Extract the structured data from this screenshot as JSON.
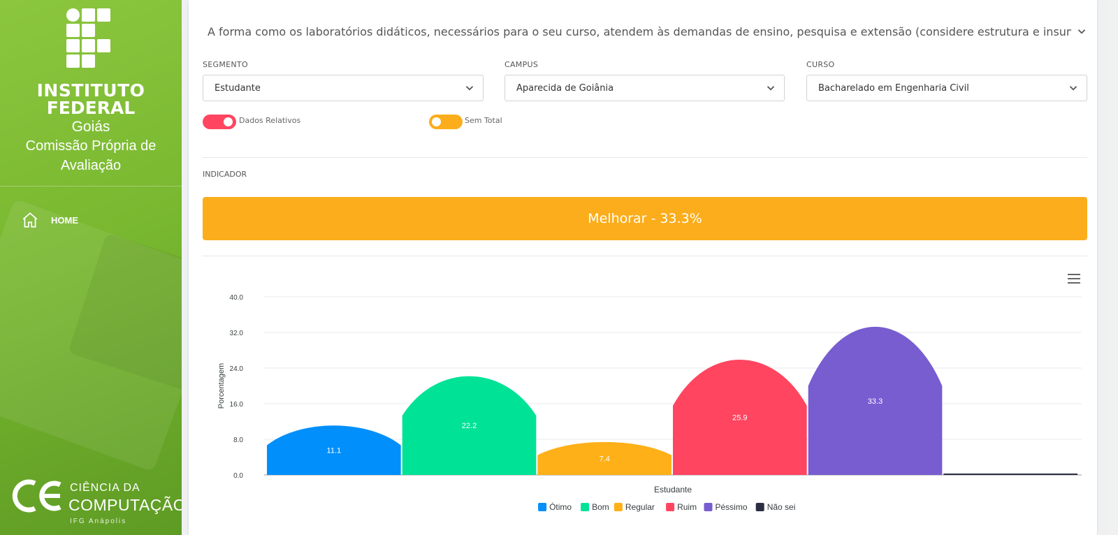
{
  "sidebar": {
    "brand_line1": "INSTITUTO",
    "brand_line2": "FEDERAL",
    "brand_line3": "Goiás",
    "brand_line4": "Comissão Própria de Avaliação",
    "nav_home": "HOME",
    "cc_line1": "CIÊNCIA DA",
    "cc_line2": "COMPUTAÇÃO",
    "cc_line3": "IFG Anápolis"
  },
  "question": "A forma como os laboratórios didáticos, necessários para o seu curso, atendem às demandas de ensino, pesquisa e extensão (considere estrutura e insumos",
  "filters": {
    "segmento_label": "SEGMENTO",
    "segmento_value": "Estudante",
    "campus_label": "CAMPUS",
    "campus_value": "Aparecida de Goiânia",
    "curso_label": "CURSO",
    "curso_value": "Bacharelado em Engenharia Civil"
  },
  "toggles": {
    "relativos_label": "Dados Relativos",
    "relativos_color": "#ff4560",
    "total_label": "Sem Total",
    "total_color": "#fbad1b"
  },
  "indicator": {
    "label": "INDICADOR",
    "text": "Melhorar - 33.3%",
    "color": "#fbad1b"
  },
  "chart_data": {
    "type": "bar",
    "xlabel": "Estudante",
    "ylabel": "Porcentagem",
    "ylim": [
      0,
      40
    ],
    "yticks": [
      "0.0",
      "8.0",
      "16.0",
      "24.0",
      "32.0",
      "40.0"
    ],
    "grid": true,
    "legend_position": "bottom",
    "series": [
      {
        "name": "Ótimo",
        "value": 11.1,
        "label": "11.1",
        "color": "#008ffb"
      },
      {
        "name": "Bom",
        "value": 22.2,
        "label": "22.2",
        "color": "#00e396"
      },
      {
        "name": "Regular",
        "value": 7.4,
        "label": "7.4",
        "color": "#feb019"
      },
      {
        "name": "Ruim",
        "value": 25.9,
        "label": "25.9",
        "color": "#ff4560"
      },
      {
        "name": "Péssimo",
        "value": 33.3,
        "label": "33.3",
        "color": "#775dd0"
      },
      {
        "name": "Não sei",
        "value": 0,
        "label": "",
        "color": "#2b2d42"
      }
    ]
  }
}
